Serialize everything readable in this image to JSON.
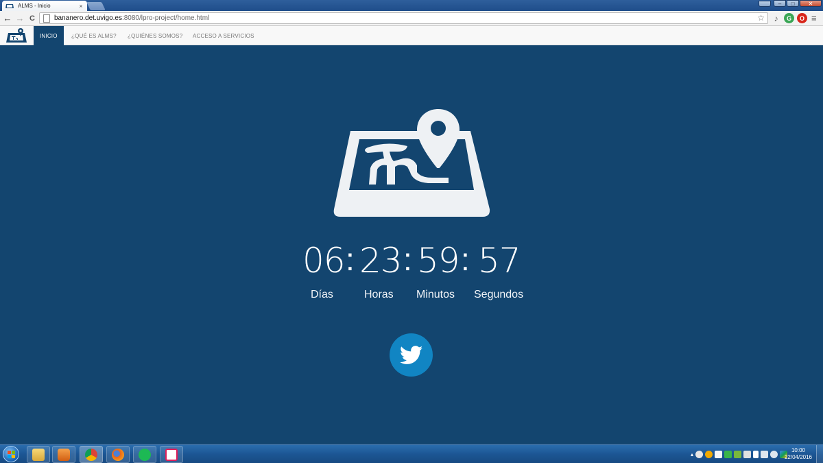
{
  "browser": {
    "tab_title": "ALMS - Inicio",
    "tab_close": "×",
    "url_host": "bananero.det.uvigo.es",
    "url_rest": ":8080/lpro-project/home.html",
    "back": "←",
    "forward": "→",
    "reload": "C",
    "star": "☆",
    "menu": "≡"
  },
  "site_nav": {
    "items": [
      {
        "label": "INICIO",
        "active": true
      },
      {
        "label": "¿QUÉ ES ALMS?"
      },
      {
        "label": "¿QUIÉNES SOMOS?"
      },
      {
        "label": "ACCESO A SERVICIOS"
      }
    ]
  },
  "countdown": {
    "days": "06",
    "hours": "23",
    "minutes": "59",
    "seconds": "57",
    "separator": ":",
    "labels": {
      "days": "Días",
      "hours": "Horas",
      "minutes": "Minutos",
      "seconds": "Segundos"
    }
  },
  "social": {
    "icon": "twitter-icon"
  },
  "taskbar": {
    "apps": [
      "file-explorer-icon",
      "media-player-icon",
      "chrome-icon",
      "firefox-icon",
      "spotify-icon",
      "slack-icon"
    ],
    "clock_time": "10:00",
    "clock_date": "22/04/2016"
  },
  "colors": {
    "page_bg": "#13456f",
    "nav_active": "#13456f",
    "twitter": "#1185c3",
    "logo": "#eef1f4"
  }
}
